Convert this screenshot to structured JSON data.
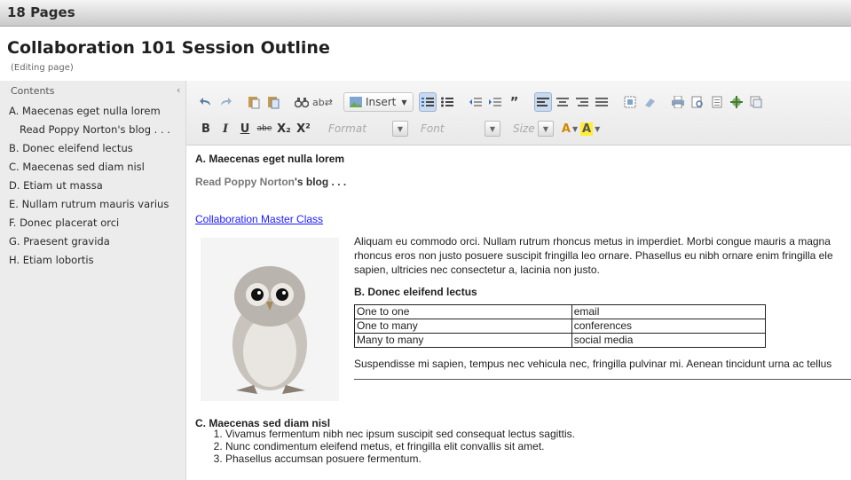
{
  "app": {
    "page_count_title": "18 Pages"
  },
  "page": {
    "title": "Collaboration 101 Session Outline",
    "status": "(Editing page)"
  },
  "sidebar": {
    "header": "Contents",
    "items": [
      {
        "label": "A. Maecenas eget nulla lorem"
      },
      {
        "label": "Read Poppy Norton's blog . . ."
      },
      {
        "label": "B. Donec eleifend lectus"
      },
      {
        "label": "C. Maecenas sed diam nisl"
      },
      {
        "label": "D. Etiam ut massa"
      },
      {
        "label": "E. Nullam rutrum mauris varius"
      },
      {
        "label": "F. Donec placerat orci"
      },
      {
        "label": "G. Praesent gravida"
      },
      {
        "label": "H. Etiam lobortis"
      }
    ]
  },
  "toolbar": {
    "insert_label": "Insert",
    "format_placeholder": "Format",
    "font_placeholder": "Font",
    "size_placeholder": "Size",
    "bold": "B",
    "italic": "I",
    "underline": "U",
    "strike": "abe",
    "subscript": "X₂",
    "superscript": "X²",
    "text_color": "A",
    "bg_color": "A"
  },
  "content": {
    "heading_a": "A. Maecenas eget nulla lorem",
    "blog_prefix": "Read Poppy Norton",
    "blog_suffix": "'s blog . . .",
    "link": "Collaboration Master Class",
    "para1": [
      "Aliquam eu commodo orci. Nullam rutrum rhoncus metus in imperdiet. Morbi congue mauris a magna",
      "rhoncus eros non justo posuere suscipit fringilla leo ornare. Phasellus eu nibh ornare enim fringilla ele",
      "sapien, ultricies nec consectetur a, lacinia non justo."
    ],
    "heading_b": "B. Donec eleifend lectus",
    "table": [
      [
        "One to one",
        "email"
      ],
      [
        "One to many",
        "conferences"
      ],
      [
        "Many to many",
        "social media"
      ]
    ],
    "para2": "Suspendisse mi sapien, tempus nec vehicula nec, fringilla pulvinar mi. Aenean tincidunt urna ac tellus",
    "heading_c": "C. Maecenas sed diam nisl",
    "list": [
      "Vivamus fermentum nibh nec ipsum suscipit sed consequat lectus sagittis.",
      "Nunc condimentum eleifend metus, et fringilla elit convallis sit amet.",
      "Phasellus accumsan posuere fermentum."
    ]
  }
}
